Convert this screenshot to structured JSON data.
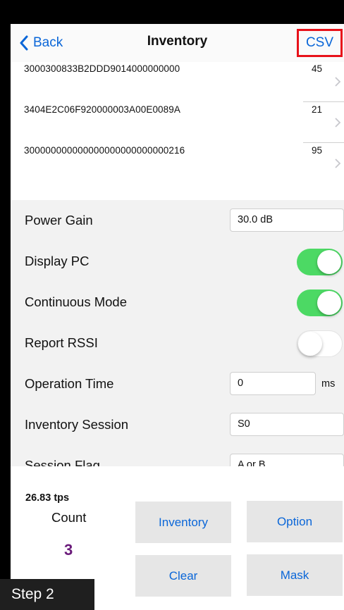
{
  "nav": {
    "back_label": "Back",
    "title": "Inventory",
    "csv_label": "CSV"
  },
  "tags": [
    {
      "epc": "3000300833B2DDD9014000000000",
      "count": "45"
    },
    {
      "epc": "3404E2C06F920000003A00E0089A",
      "count": "21"
    },
    {
      "epc": "300000000000000000000000000216",
      "count": "95"
    }
  ],
  "settings": {
    "power_gain": {
      "label": "Power Gain",
      "value": "30.0 dB"
    },
    "display_pc": {
      "label": "Display PC",
      "on": true
    },
    "continuous_mode": {
      "label": "Continuous Mode",
      "on": true
    },
    "report_rssi": {
      "label": "Report RSSI",
      "on": false
    },
    "operation_time": {
      "label": "Operation Time",
      "value": "0",
      "unit": "ms"
    },
    "inventory_session": {
      "label": "Inventory Session",
      "value": "S0"
    },
    "session_flag": {
      "label": "Session Flag",
      "value": "A or B"
    }
  },
  "stats": {
    "rate": "26.83 tps",
    "count_label": "Count",
    "count_value": "3"
  },
  "buttons": {
    "inventory": "Inventory",
    "option": "Option",
    "clear": "Clear",
    "mask": "Mask"
  },
  "overlay": {
    "step": "Step 2"
  },
  "colors": {
    "accent": "#0a66d8",
    "toggle_on": "#4cd964",
    "highlight": "#e8121a",
    "count_value": "#6a1b7a"
  }
}
